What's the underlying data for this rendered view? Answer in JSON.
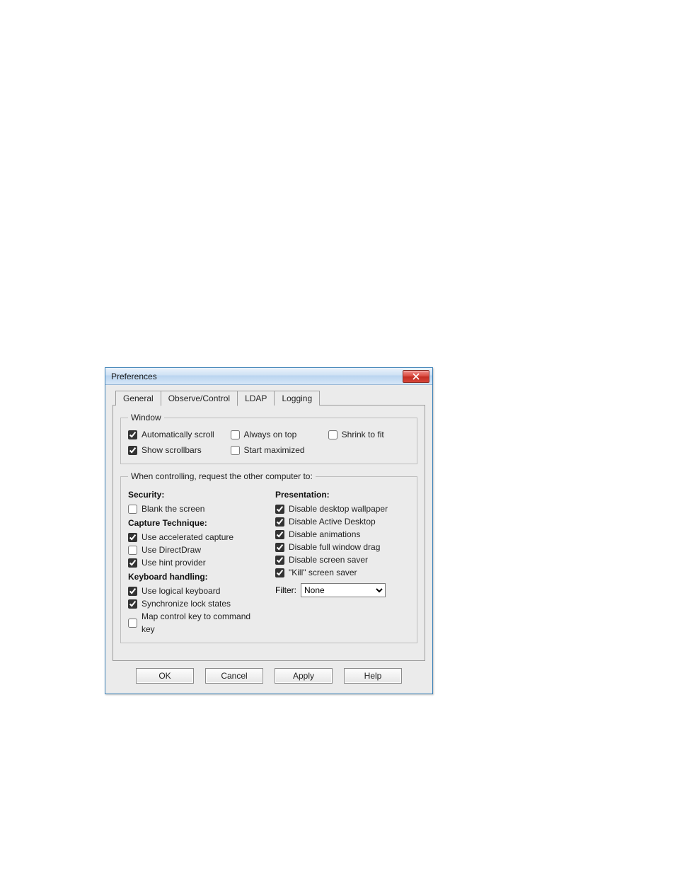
{
  "window": {
    "title": "Preferences"
  },
  "tabs": {
    "general": "General",
    "observe": "Observe/Control",
    "ldap": "LDAP",
    "logging": "Logging"
  },
  "groups": {
    "window": {
      "legend": "Window",
      "auto_scroll": {
        "label": "Automatically scroll",
        "checked": true
      },
      "always_on_top": {
        "label": "Always on top",
        "checked": false
      },
      "shrink_to_fit": {
        "label": "Shrink to fit",
        "checked": false
      },
      "show_scrollbars": {
        "label": "Show scrollbars",
        "checked": true
      },
      "start_maximized": {
        "label": "Start maximized",
        "checked": false
      }
    },
    "control": {
      "legend": "When controlling, request the other computer to:",
      "security": {
        "title": "Security:",
        "blank_screen": {
          "label": "Blank the screen",
          "checked": false
        }
      },
      "capture": {
        "title": "Capture Technique:",
        "accel": {
          "label": "Use accelerated capture",
          "checked": true
        },
        "directdraw": {
          "label": "Use DirectDraw",
          "checked": false
        },
        "hint": {
          "label": "Use hint provider",
          "checked": true
        }
      },
      "keyboard": {
        "title": "Keyboard handling:",
        "logical": {
          "label": "Use logical keyboard",
          "checked": true
        },
        "sync_lock": {
          "label": "Synchronize lock states",
          "checked": true
        },
        "map_ctrl": {
          "label": "Map control key to command key",
          "checked": false
        }
      },
      "presentation": {
        "title": "Presentation:",
        "wallpaper": {
          "label": "Disable desktop wallpaper",
          "checked": true
        },
        "active_desktop": {
          "label": "Disable Active Desktop",
          "checked": true
        },
        "animations": {
          "label": "Disable animations",
          "checked": true
        },
        "full_drag": {
          "label": "Disable full window drag",
          "checked": true
        },
        "screensaver": {
          "label": "Disable screen saver",
          "checked": true
        },
        "kill_ss": {
          "label": "\"Kill\" screen saver",
          "checked": true
        }
      },
      "filter": {
        "label": "Filter:",
        "value": "None",
        "options": [
          "None"
        ]
      }
    }
  },
  "buttons": {
    "ok": "OK",
    "cancel": "Cancel",
    "apply": "Apply",
    "help": "Help"
  }
}
